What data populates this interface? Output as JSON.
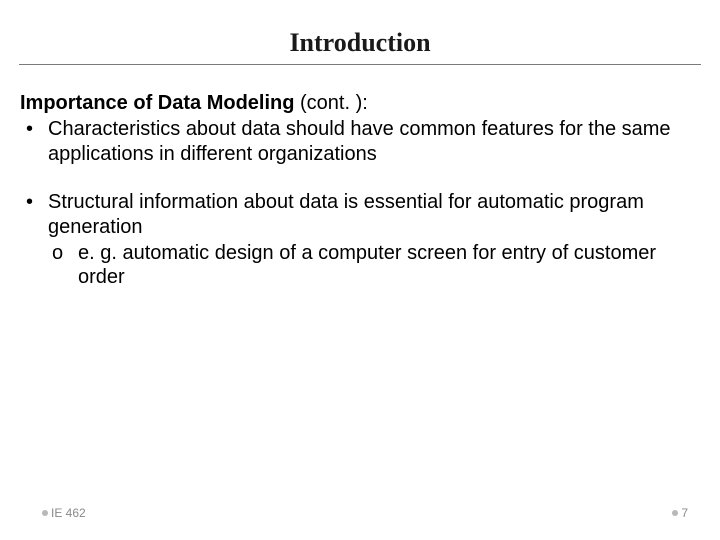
{
  "title": "Introduction",
  "subheading_bold": "Importance of Data Modeling",
  "subheading_rest": " (cont. ):",
  "bullets": [
    "Characteristics about data should have common features for the same applications in different organizations",
    "Structural information about data is essential for automatic program generation"
  ],
  "subbullet_marker": "o",
  "subbullet": "e. g. automatic design of a computer screen for entry of customer order",
  "bullet_marker": "•",
  "footer_left": "IE 462",
  "footer_right": "7"
}
